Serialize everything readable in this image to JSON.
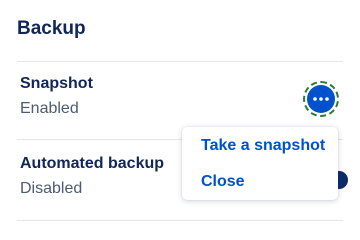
{
  "section": {
    "title": "Backup"
  },
  "rows": [
    {
      "name": "Snapshot",
      "status": "Enabled"
    },
    {
      "name": "Automated backup",
      "status": "Disabled"
    }
  ],
  "actions_menu": {
    "button_icon": "more-horizontal-icon",
    "items": [
      {
        "label": "Take a snapshot"
      },
      {
        "label": "Close"
      }
    ]
  },
  "colors": {
    "heading": "#102659",
    "muted_text": "#4a5b73",
    "accent": "#0052cc",
    "focus_ring": "#2b7a35",
    "divider": "#e4e8ee"
  }
}
